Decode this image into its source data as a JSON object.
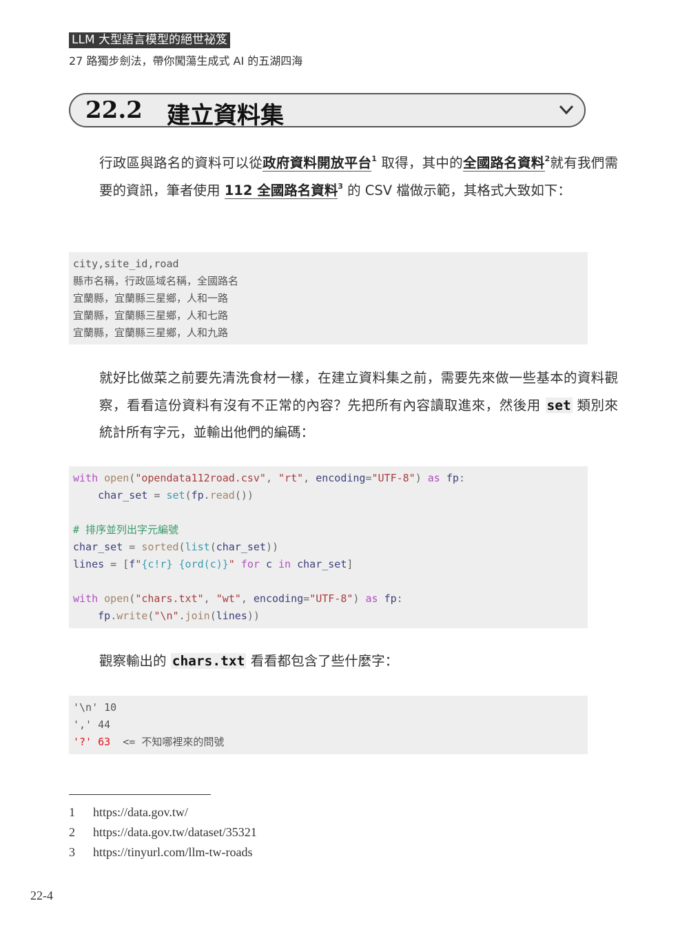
{
  "header": {
    "book_title": "LLM 大型語言模型的絕世祕笈",
    "subtitle": "27 路獨步劍法，帶你闖蕩生成式 AI 的五湖四海"
  },
  "section": {
    "number": "22.2",
    "title": "建立資料集",
    "icon": "chevron-down-icon"
  },
  "para1": {
    "t1": "行政區與路名的資料可以從",
    "link1": "政府資料開放平台",
    "sup1": "1",
    "t2": "取得，其中的",
    "link2": "全國路名資料",
    "sup2": "2",
    "t3": "就有我們需要的資訊，筆者使用 ",
    "link3": "112 全國路名資料",
    "sup3": "3",
    "t4": "的 CSV 檔做示範，其格式大致如下："
  },
  "csv_lines": [
    "city,site_id,road",
    "縣市名稱，行政區域名稱，全國路名",
    "宜蘭縣，宜蘭縣三星鄉，人和一路",
    "宜蘭縣，宜蘭縣三星鄉，人和七路",
    "宜蘭縣，宜蘭縣三星鄉，人和九路"
  ],
  "para2": {
    "t1": "就好比做菜之前要先清洗食材一樣，在建立資料集之前，需要先來做一些基本的資料觀察，看看這份資料有沒有不正常的內容？先把所有內容讀取進來，然後用 ",
    "code": "set",
    "t2": " 類別來統計所有字元，並輸出他們的編碼："
  },
  "code_lines": [
    [
      [
        "kw",
        "with"
      ],
      [
        "op",
        " "
      ],
      [
        "fn",
        "open"
      ],
      [
        "op",
        "("
      ],
      [
        "str",
        "\"opendata112road.csv\""
      ],
      [
        "op",
        ", "
      ],
      [
        "str",
        "\"rt\""
      ],
      [
        "op",
        ", "
      ],
      [
        "id",
        "encoding"
      ],
      [
        "op",
        "="
      ],
      [
        "str",
        "\"UTF-8\""
      ],
      [
        "op",
        ") "
      ],
      [
        "kw",
        "as"
      ],
      [
        "op",
        " "
      ],
      [
        "id",
        "fp"
      ],
      [
        "op",
        ":"
      ]
    ],
    [
      [
        "op",
        "    "
      ],
      [
        "id",
        "char_set"
      ],
      [
        "op",
        " = "
      ],
      [
        "bi",
        "set"
      ],
      [
        "op",
        "("
      ],
      [
        "id",
        "fp"
      ],
      [
        "op",
        "."
      ],
      [
        "fn",
        "read"
      ],
      [
        "op",
        "())"
      ]
    ],
    [],
    [
      [
        "cm",
        "# 排序並列出字元編號"
      ]
    ],
    [
      [
        "id",
        "char_set"
      ],
      [
        "op",
        " = "
      ],
      [
        "fn",
        "sorted"
      ],
      [
        "op",
        "("
      ],
      [
        "bi",
        "list"
      ],
      [
        "op",
        "("
      ],
      [
        "id",
        "char_set"
      ],
      [
        "op",
        "))"
      ]
    ],
    [
      [
        "id",
        "lines"
      ],
      [
        "op",
        " = ["
      ],
      [
        "id",
        "f"
      ],
      [
        "str",
        "\""
      ],
      [
        "bi",
        "{c!r}"
      ],
      [
        "op",
        " "
      ],
      [
        "bi",
        "{ord(c)}"
      ],
      [
        "str",
        "\""
      ],
      [
        "op",
        " "
      ],
      [
        "kw",
        "for"
      ],
      [
        "op",
        " "
      ],
      [
        "id",
        "c"
      ],
      [
        "op",
        " "
      ],
      [
        "kw",
        "in"
      ],
      [
        "op",
        " "
      ],
      [
        "id",
        "char_set"
      ],
      [
        "op",
        "]"
      ]
    ],
    [],
    [
      [
        "kw",
        "with"
      ],
      [
        "op",
        " "
      ],
      [
        "fn",
        "open"
      ],
      [
        "op",
        "("
      ],
      [
        "str",
        "\"chars.txt\""
      ],
      [
        "op",
        ", "
      ],
      [
        "str",
        "\"wt\""
      ],
      [
        "op",
        ", "
      ],
      [
        "id",
        "encoding"
      ],
      [
        "op",
        "="
      ],
      [
        "str",
        "\"UTF-8\""
      ],
      [
        "op",
        ") "
      ],
      [
        "kw",
        "as"
      ],
      [
        "op",
        " "
      ],
      [
        "id",
        "fp"
      ],
      [
        "op",
        ":"
      ]
    ],
    [
      [
        "op",
        "    "
      ],
      [
        "id",
        "fp"
      ],
      [
        "op",
        "."
      ],
      [
        "fn",
        "write"
      ],
      [
        "op",
        "("
      ],
      [
        "str",
        "\"\\n\""
      ],
      [
        "op",
        "."
      ],
      [
        "fn",
        "join"
      ],
      [
        "op",
        "("
      ],
      [
        "id",
        "lines"
      ],
      [
        "op",
        "))"
      ]
    ]
  ],
  "para3": {
    "t1": "觀察輸出的 ",
    "code": "chars.txt",
    "t2": " 看看都包含了些什麼字："
  },
  "output_lines": [
    [
      [
        "plain",
        "'\\n' 10"
      ]
    ],
    [
      [
        "plain",
        "',' 44"
      ]
    ],
    [
      [
        "red",
        "'?' 63"
      ],
      [
        "plain",
        "  <= "
      ],
      [
        "plain",
        "不知哪裡來的問號"
      ]
    ]
  ],
  "highlight_color": "#e0101a",
  "footnotes": [
    {
      "n": "1",
      "url": "https://data.gov.tw/"
    },
    {
      "n": "2",
      "url": "https://data.gov.tw/dataset/35321"
    },
    {
      "n": "3",
      "url": "https://tinyurl.com/llm-tw-roads"
    }
  ],
  "page_number": "22-4"
}
